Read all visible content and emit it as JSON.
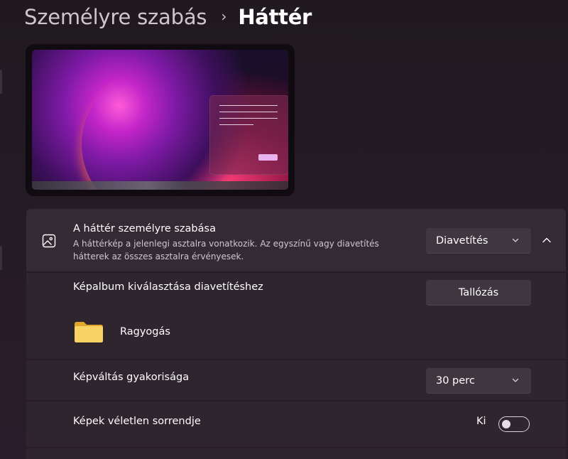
{
  "breadcrumb": {
    "parent": "Személyre szabás",
    "separator": "›",
    "current": "Háttér"
  },
  "background_settings": {
    "title": "A háttér személyre szabása",
    "description": "A háttérkép a jelenlegi asztalra vonatkozik. Az egyszínű vagy diavetítés hátterek az összes asztalra érvényesek.",
    "selected_type": "Diavetítés",
    "expanded": true,
    "album_label": "Képalbum kiválasztása diavetítéshez",
    "browse_label": "Tallózás",
    "folder_name": "Ragyogás",
    "interval_label": "Képváltás gyakorisága",
    "interval_value": "30 perc",
    "shuffle_label": "Képek véletlen sorrendje",
    "shuffle_state": "Ki"
  },
  "icons": {
    "header": "image-icon",
    "dropdown": "chevron-down-icon",
    "expand": "chevron-up-icon",
    "folder": "folder-icon"
  },
  "colors": {
    "folder": "#f5c842",
    "card": "#342a34",
    "control": "#3f363f"
  }
}
